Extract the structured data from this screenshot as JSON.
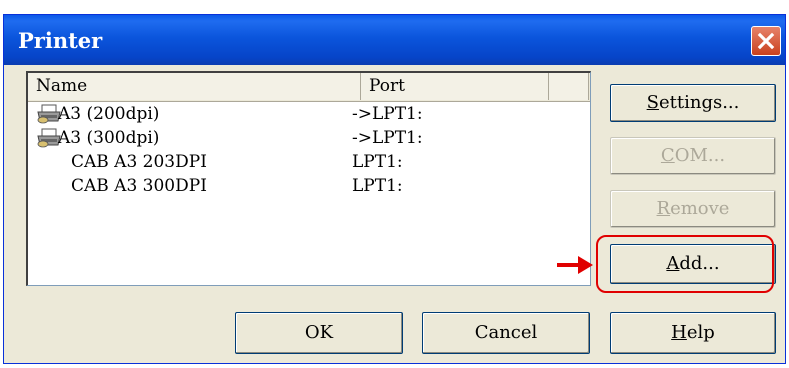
{
  "window": {
    "title": "Printer"
  },
  "list": {
    "columns": {
      "name": "Name",
      "port": "Port"
    },
    "rows": [
      {
        "name": "A3 (200dpi)",
        "port": "->LPT1:",
        "has_icon": true
      },
      {
        "name": "A3 (300dpi)",
        "port": "->LPT1:",
        "has_icon": true
      },
      {
        "name": "CAB A3 203DPI",
        "port": "LPT1:",
        "has_icon": false
      },
      {
        "name": "CAB A3 300DPI",
        "port": "LPT1:",
        "has_icon": false
      }
    ]
  },
  "buttons": {
    "settings": {
      "pre": "",
      "u": "S",
      "post": "ettings..."
    },
    "com": {
      "pre": "",
      "u": "C",
      "post": "OM..."
    },
    "remove": {
      "pre": "",
      "u": "R",
      "post": "emove"
    },
    "add": {
      "pre": "",
      "u": "A",
      "post": "dd..."
    },
    "ok": {
      "label": "OK"
    },
    "cancel": {
      "label": "Cancel"
    },
    "help": {
      "pre": "",
      "u": "H",
      "post": "elp"
    }
  },
  "colors": {
    "annotation": "#e00000",
    "titlebar": "#0a58e8",
    "face": "#ece9d8"
  },
  "icons": [
    "close-icon",
    "printer-icon",
    "red-arrow-icon"
  ]
}
